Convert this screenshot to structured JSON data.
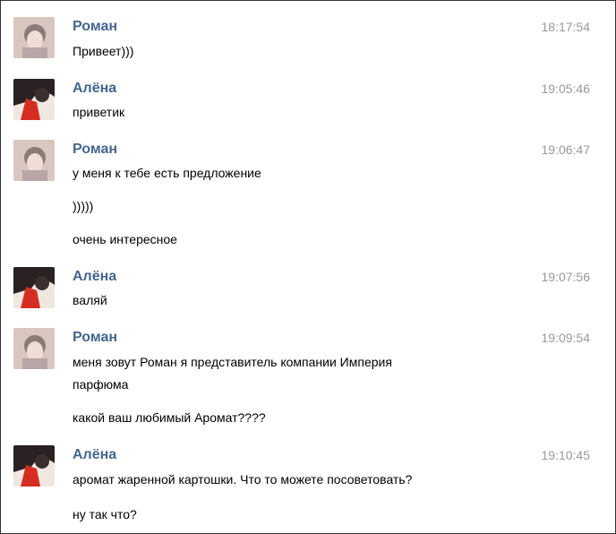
{
  "messages": [
    {
      "author": "Роман",
      "time": "18:17:54",
      "avatar_icon": "roman-avatar-icon",
      "lines": [
        "Привеет)))"
      ]
    },
    {
      "author": "Алёна",
      "time": "19:05:46",
      "avatar_icon": "alena-avatar-icon",
      "lines": [
        "приветик"
      ]
    },
    {
      "author": "Роман",
      "time": "19:06:47",
      "avatar_icon": "roman-avatar-icon",
      "lines": [
        "у меня к тебе есть предложение",
        ")))))",
        "очень интересное"
      ]
    },
    {
      "author": "Алёна",
      "time": "19:07:56",
      "avatar_icon": "alena-avatar-icon",
      "lines": [
        "валяй"
      ]
    },
    {
      "author": "Роман",
      "time": "19:09:54",
      "avatar_icon": "roman-avatar-icon",
      "lines": [
        "меня зовут Роман я представитель компании Империя",
        "парфюма",
        "какой ваш любимый Аромат????"
      ]
    },
    {
      "author": "Алёна",
      "time": "19:10:45",
      "avatar_icon": "alena-avatar-icon",
      "lines": [
        "аромат жаренной картошки. Что то можете посоветовать?",
        "ну так что?"
      ]
    }
  ],
  "colors": {
    "author_name": "#45668e",
    "timestamp": "#999999",
    "text": "#000000"
  }
}
